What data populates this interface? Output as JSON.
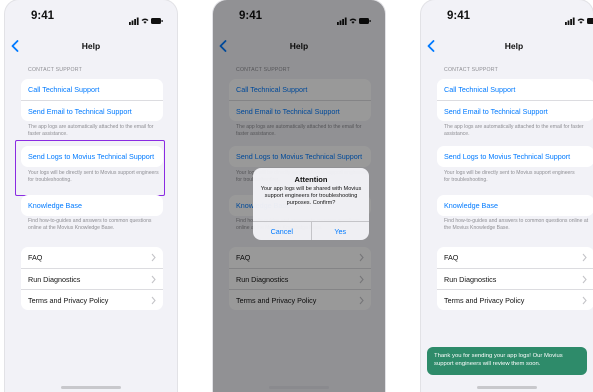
{
  "status": {
    "time": "9:41"
  },
  "nav": {
    "title": "Help"
  },
  "contact_header": "CONTACT SUPPORT",
  "rows": {
    "call": "Call Technical Support",
    "email": "Send Email to Technical Support",
    "logs": "Send Logs to Movius Technical Support",
    "kb": "Knowledge Base",
    "faq": "FAQ",
    "diag": "Run Diagnostics",
    "terms": "Terms and Privacy Policy"
  },
  "footnotes": {
    "email": "The app logs are automatically attached to the email for faster assistance.",
    "logs": "Your logs will be directly sent to Movius support engineers for troubleshooting.",
    "kb": "Find how-to-guides and answers to common questions online at the Movius Knowledge Base."
  },
  "alert": {
    "title": "Attention",
    "message": "Your app logs will be shared with Movius support engineers for troubleshooting purposes. Confirm?",
    "cancel": "Cancel",
    "confirm": "Yes"
  },
  "toast": {
    "message": "Thank you for sending your app logs! Our Movius support engineers will review them soon."
  },
  "colors": {
    "accent": "#007aff",
    "highlight": "#8a2be2",
    "toast": "#2e8b6a"
  }
}
